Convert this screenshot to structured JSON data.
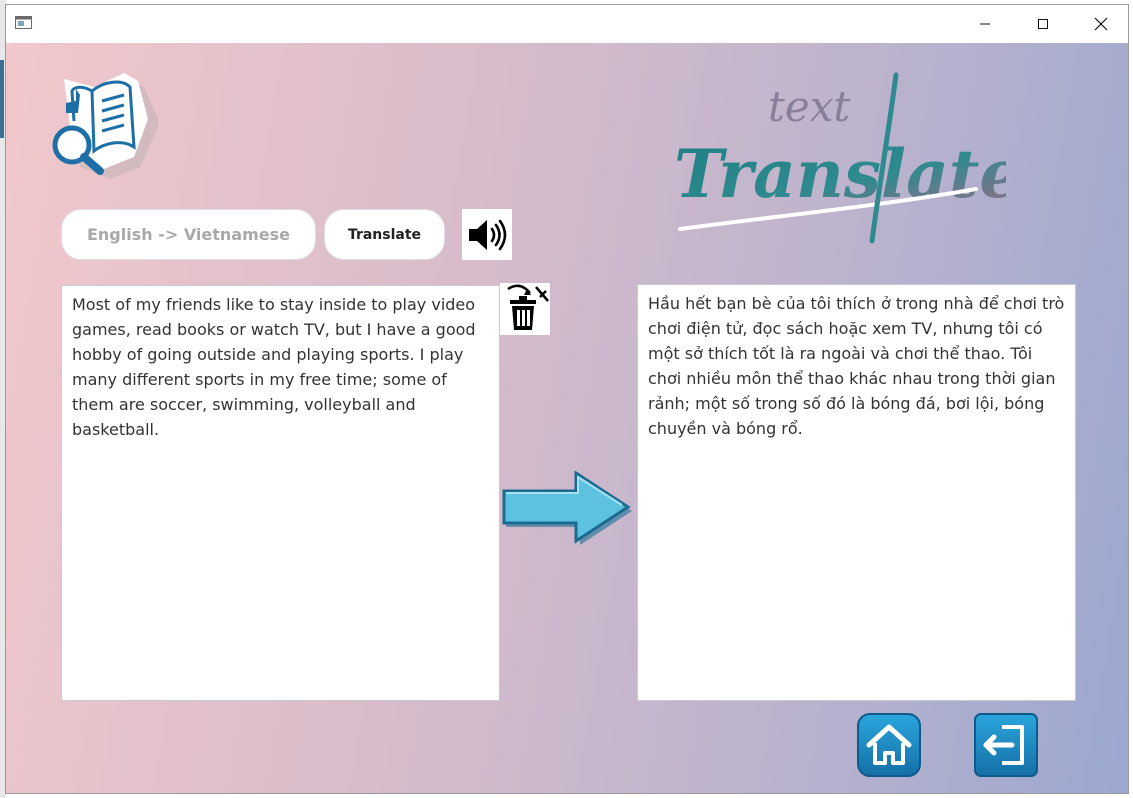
{
  "window": {
    "controls": [
      "minimize",
      "maximize",
      "close"
    ]
  },
  "toolbar": {
    "direction_label": "English -> Vietnamese",
    "translate_label": "Translate"
  },
  "brand": {
    "small": "text",
    "big": "Translate"
  },
  "source": {
    "text": "Most of my friends like to stay inside to play video games, read books or watch TV, but I have a good hobby of going outside and playing sports. I play many different sports in my free time; some of them are soccer, swimming, volleyball and basketball."
  },
  "result": {
    "text": "Hầu hết bạn bè của tôi thích ở trong nhà để chơi trò chơi điện tử, đọc sách hoặc xem TV, nhưng tôi có một sở thích tốt là ra ngoài và chơi thể thao. Tôi chơi nhiều môn thể thao khác nhau trong thời gian rảnh; một số trong số đó là bóng đá, bơi lội, bóng chuyền và bóng rổ."
  },
  "icons": {
    "logo": "book-search-icon",
    "sound": "speaker-icon",
    "clear": "trash-icon",
    "arrow": "arrow-right-icon",
    "home": "home-icon",
    "exit": "exit-icon"
  },
  "colors": {
    "accent_blue": "#1d8fc7",
    "brand_teal": "#1f7f86",
    "brand_mauve": "#a06a86",
    "bg_pink": "#f1c8cb",
    "bg_blue": "#9ba8d0"
  }
}
